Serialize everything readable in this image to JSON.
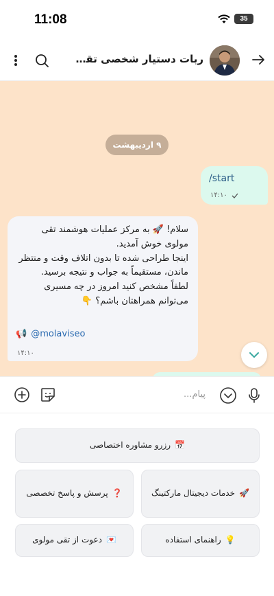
{
  "status_bar": {
    "time": "11:08",
    "battery": "35"
  },
  "header": {
    "title": "ربات دستیار شخصی تقی مولو...",
    "icons": [
      "back-arrow-icon",
      "search-icon",
      "more-vertical-icon"
    ]
  },
  "chat": {
    "date": "۹ اردیبهشت",
    "outgoing": {
      "text": "/start",
      "time": "۱۴:۱۰"
    },
    "incoming": {
      "text_lines": [
        "سلام! 🚀 به مرکز عملیات هوشمند تقی",
        "مولوی خوش آمدید.",
        "اینجا طراحی شده تا بدون اتلاف وقت و منتظر",
        "ماندن، مستقیماً به جواب و نتیجه برسید.",
        "لطفاً مشخص کنید امروز در چه مسیری",
        "می‌توانم همراهتان باشم؟ 👇"
      ],
      "link": "@molaviseo",
      "link_icon": "📢",
      "time": "۱۴:۱۰"
    }
  },
  "input": {
    "placeholder": "پیام..."
  },
  "keyboard": {
    "buttons": [
      {
        "emoji": "📅",
        "label": "رزرو مشاوره اختصاصی"
      },
      {
        "emoji": "🚀",
        "label": "خدمات دیجیتال مارکتینگ"
      },
      {
        "emoji": "❓",
        "label": "پرسش و پاسخ تخصصی"
      },
      {
        "emoji": "💡",
        "label": "راهنمای استفاده"
      },
      {
        "emoji": "💌",
        "label": "دعوت از تقی مولوی"
      }
    ]
  },
  "colors": {
    "chat_bg": "#fde3c9",
    "outgoing_bubble": "#dcf9ee",
    "incoming_bubble": "#f4f5f9",
    "date_pill": "#c5ae98",
    "link": "#2a6ab0"
  }
}
